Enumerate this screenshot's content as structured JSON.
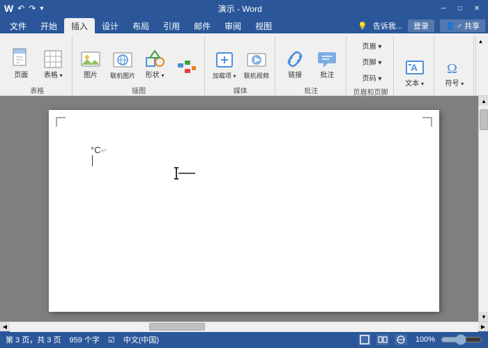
{
  "titlebar": {
    "title": "演示 - Word",
    "undo": "↶",
    "redo": "↷",
    "customize": "▾",
    "minimize": "─",
    "restore": "□",
    "close": "✕",
    "ribbon_collapse": "▲"
  },
  "tabs": [
    {
      "id": "file",
      "label": "文件"
    },
    {
      "id": "home",
      "label": "开始"
    },
    {
      "id": "insert",
      "label": "插入",
      "active": true
    },
    {
      "id": "design",
      "label": "设计"
    },
    {
      "id": "layout",
      "label": "布局"
    },
    {
      "id": "references",
      "label": "引用"
    },
    {
      "id": "mailing",
      "label": "邮件"
    },
    {
      "id": "review",
      "label": "审阅"
    },
    {
      "id": "view",
      "label": "视图"
    }
  ],
  "ribbon": {
    "groups": [
      {
        "id": "page",
        "label": "表格",
        "buttons": [
          {
            "id": "pages",
            "label": "页面",
            "icon": "📄",
            "large": true
          },
          {
            "id": "table",
            "label": "表格",
            "icon": "⊞",
            "large": true
          }
        ]
      },
      {
        "id": "illustrations",
        "label": "插图",
        "buttons": [
          {
            "id": "picture",
            "label": "图片",
            "icon": "🖼",
            "large": true
          },
          {
            "id": "online-pic",
            "label": "联机图片",
            "icon": "🌐",
            "large": true
          },
          {
            "id": "shapes",
            "label": "形状",
            "icon": "◻",
            "large": true
          },
          {
            "id": "smartart",
            "label": "",
            "icon": "📊",
            "large": true
          }
        ]
      },
      {
        "id": "addin",
        "label": "媒体",
        "buttons": [
          {
            "id": "addin",
            "label": "加载项",
            "icon": "➕",
            "large": true
          },
          {
            "id": "video",
            "label": "联机视频",
            "icon": "▶",
            "large": true
          }
        ]
      },
      {
        "id": "links",
        "label": "批注",
        "buttons": [
          {
            "id": "link",
            "label": "链接",
            "icon": "🔗",
            "large": true
          },
          {
            "id": "comment",
            "label": "批注",
            "icon": "💬",
            "large": true
          }
        ]
      },
      {
        "id": "header-footer",
        "label": "页眉和页脚",
        "buttons": [
          {
            "id": "header",
            "label": "页眉▾",
            "icon": "⬆",
            "small": true
          },
          {
            "id": "footer",
            "label": "页脚▾",
            "icon": "⬇",
            "small": true
          },
          {
            "id": "pagenumber",
            "label": "页码▾",
            "icon": "#",
            "small": true
          }
        ]
      },
      {
        "id": "text-group",
        "label": "",
        "buttons": [
          {
            "id": "textbox",
            "label": "文本",
            "icon": "A",
            "large": true
          }
        ]
      },
      {
        "id": "symbols",
        "label": "",
        "buttons": [
          {
            "id": "symbol",
            "label": "符号",
            "icon": "Ω",
            "large": true
          }
        ]
      }
    ],
    "help_text": "告诉我...",
    "login_label": "登录",
    "share_label": "♂ 共享"
  },
  "document": {
    "content_line1": "°C↵",
    "content_display": "°C"
  },
  "statusbar": {
    "page_info": "第 3 页，共 3 页",
    "word_count": "959 个字",
    "check_icon": "☑",
    "language": "中文(中国)",
    "zoom": "100%"
  },
  "scrollbar": {
    "up_arrow": "▲",
    "down_arrow": "▼",
    "left_arrow": "◀",
    "right_arrow": "▶"
  }
}
